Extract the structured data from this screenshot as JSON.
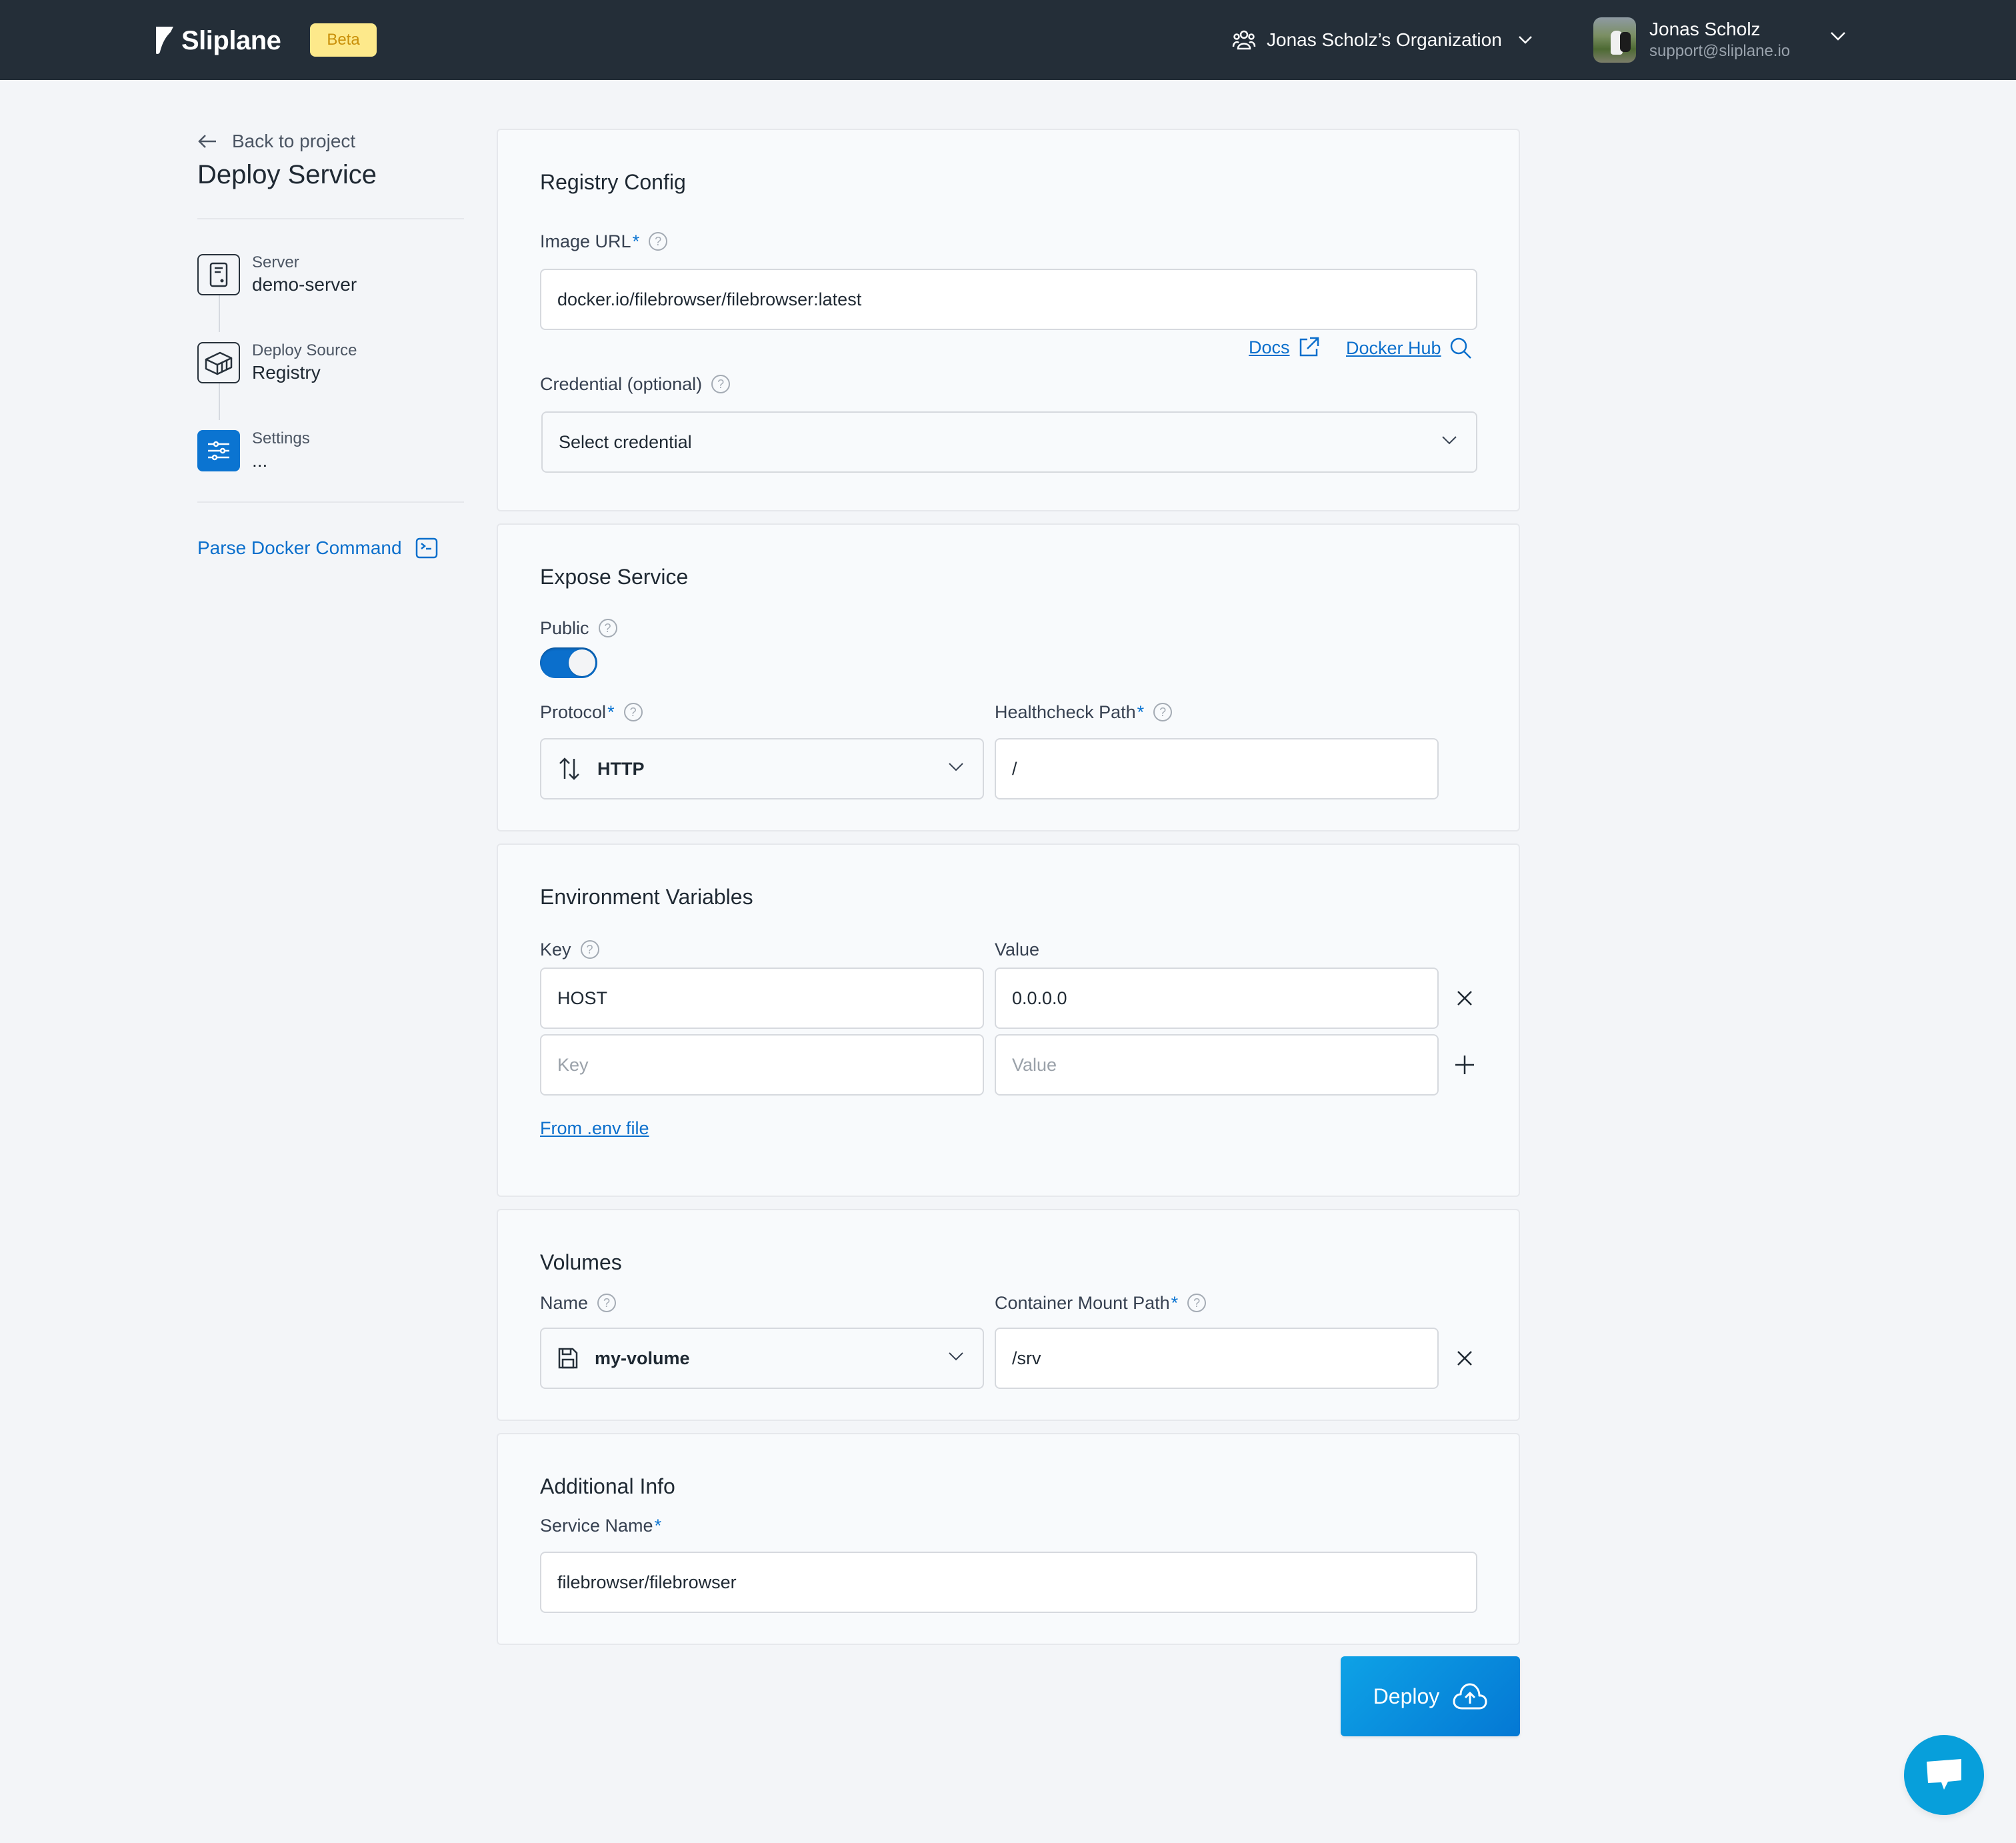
{
  "header": {
    "brand": "Sliplane",
    "badge": "Beta",
    "organization": "Jonas Scholz’s Organization",
    "user": {
      "name": "Jonas Scholz",
      "email": "support@sliplane.io"
    }
  },
  "sidebar": {
    "back_label": "Back to project",
    "title": "Deploy Service",
    "steps": [
      {
        "label": "Server",
        "value": "demo-server",
        "icon": "server-icon",
        "active": false
      },
      {
        "label": "Deploy Source",
        "value": "Registry",
        "icon": "container-icon",
        "active": false
      },
      {
        "label": "Settings",
        "value": "...",
        "icon": "sliders-icon",
        "active": true
      }
    ],
    "parse_docker_label": "Parse Docker Command"
  },
  "registry": {
    "title": "Registry Config",
    "image_url_label": "Image URL",
    "image_url_value": "docker.io/filebrowser/filebrowser:latest",
    "docs_label": "Docs",
    "docker_hub_label": "Docker Hub",
    "credential_label": "Credential (optional)",
    "credential_value": "Select credential"
  },
  "expose": {
    "title": "Expose Service",
    "public_label": "Public",
    "public_enabled": true,
    "protocol_label": "Protocol",
    "protocol_value": "HTTP",
    "healthcheck_label": "Healthcheck Path",
    "healthcheck_value": "/"
  },
  "env": {
    "title": "Environment Variables",
    "key_label": "Key",
    "value_label": "Value",
    "rows": [
      {
        "key": "HOST",
        "value": "0.0.0.0"
      }
    ],
    "new_key_placeholder": "Key",
    "new_value_placeholder": "Value",
    "from_env_label": "From .env file"
  },
  "volumes": {
    "title": "Volumes",
    "name_label": "Name",
    "mount_label": "Container Mount Path",
    "rows": [
      {
        "name": "my-volume",
        "mount": "/srv"
      }
    ]
  },
  "additional": {
    "title": "Additional Info",
    "service_name_label": "Service Name",
    "service_name_value": "filebrowser/filebrowser"
  },
  "actions": {
    "deploy_label": "Deploy"
  },
  "colors": {
    "header_bg": "#242e38",
    "accent": "#0b74d1",
    "badge_bg": "#fde98b",
    "badge_text": "#c9900a"
  }
}
